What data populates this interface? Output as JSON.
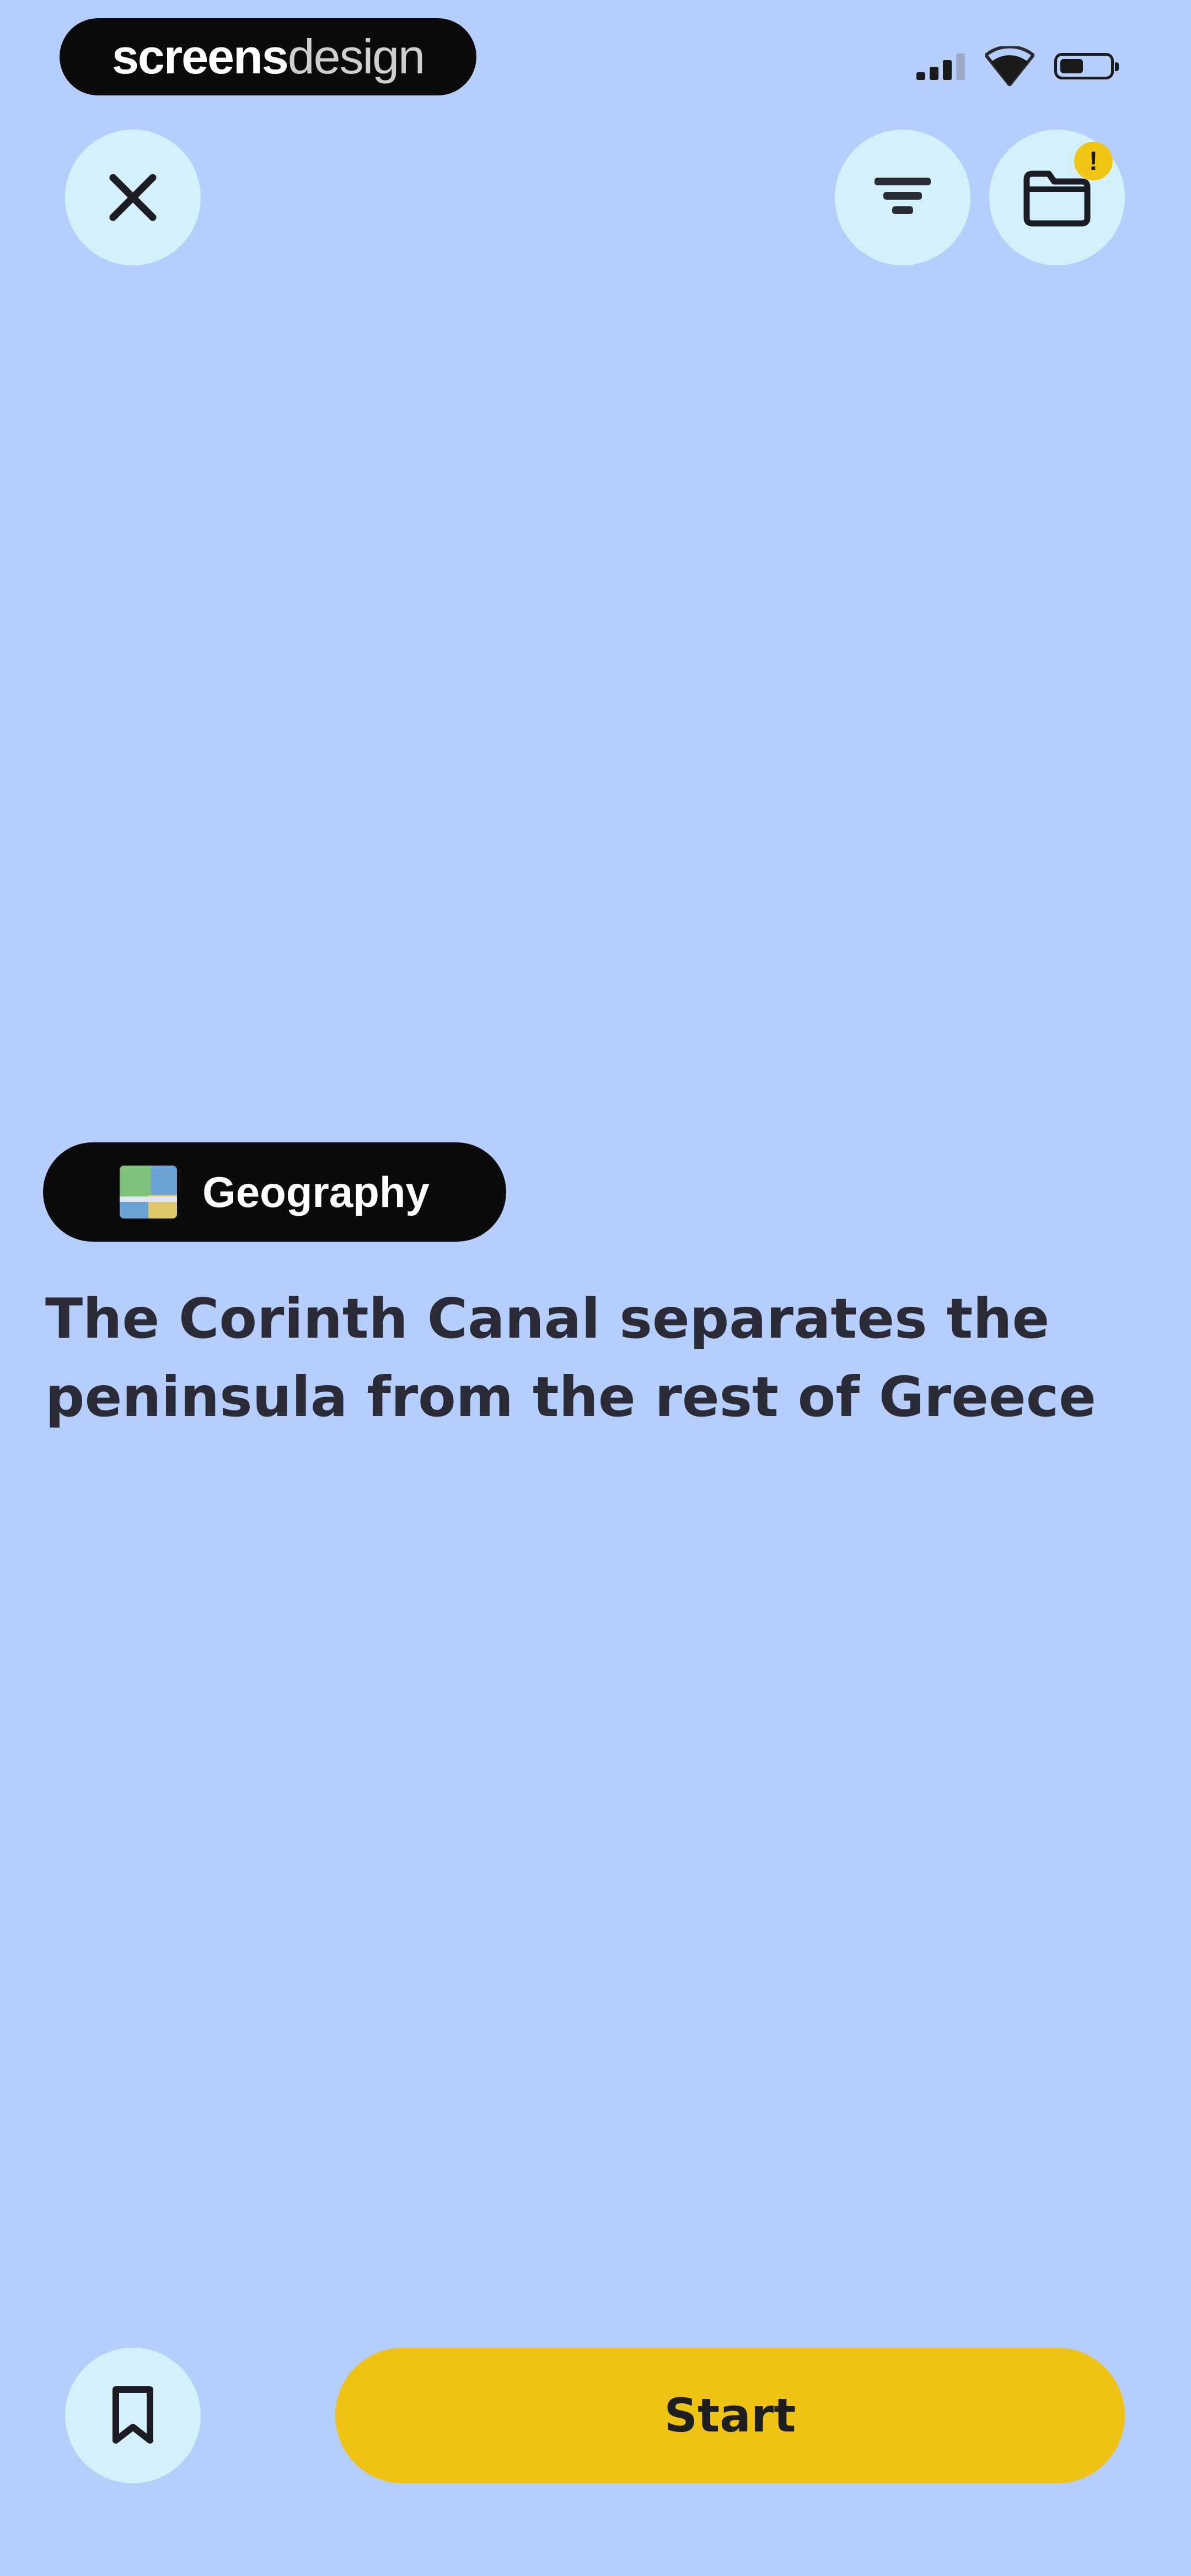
{
  "status_bar": {
    "brand_bold": "screens",
    "brand_light": "design"
  },
  "header": {
    "close_icon": "close-icon",
    "filter_icon": "filter-icon",
    "inbox_icon": "inbox-icon",
    "inbox_badge": "!"
  },
  "card": {
    "category": "Geography",
    "category_icon": "map-icon",
    "fact": "The Corinth Canal separates the peninsula from the rest of Greece"
  },
  "footer": {
    "bookmark_icon": "bookmark-icon",
    "start_label": "Start"
  },
  "colors": {
    "background": "#b6cefb",
    "accent": "#eec314",
    "round_button": "#d4f1fb",
    "chip": "#0b0b0b"
  }
}
